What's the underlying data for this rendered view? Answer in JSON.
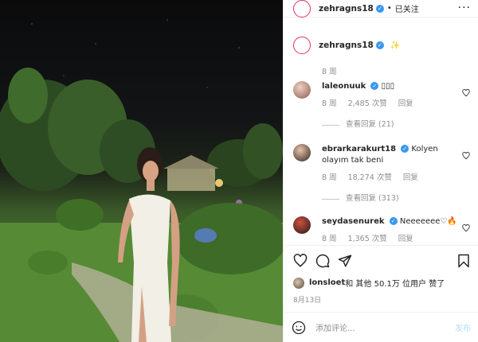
{
  "post": {
    "username": "zehragns18",
    "follow_label": "已关注",
    "caption_emoji": "✨",
    "caption_time": "8 周"
  },
  "comments": [
    {
      "user": "laleonuuk",
      "text": "▯▯▯",
      "time": "8 周",
      "likes": "2,485 次赞",
      "reply": "回复",
      "view_replies": "查看回复 (21)"
    },
    {
      "user": "ebrarkarakurt18",
      "text": "Kolyen olayım tak beni",
      "time": "8 周",
      "likes": "18,274 次赞",
      "reply": "回复",
      "view_replies": "查看回复 (313)"
    },
    {
      "user": "seydasenurek",
      "text": "Neeeeeee♡🔥",
      "time": "8 周",
      "likes": "1,365 次赞",
      "reply": "回复"
    }
  ],
  "likes_line": {
    "user": "lonsloet",
    "text": " 和 其他 50.1万 位用户 赞了"
  },
  "date": "8月13日",
  "add_comment": {
    "placeholder": "添加评论...",
    "post_label": "发布"
  },
  "colors": {
    "verified": "#3897f0",
    "post_disabled": "#b2dffc",
    "muted": "#8e8e8e"
  },
  "icons": [
    "more-options-icon",
    "heart-icon",
    "comment-icon",
    "share-icon",
    "bookmark-icon",
    "emoji-icon"
  ]
}
